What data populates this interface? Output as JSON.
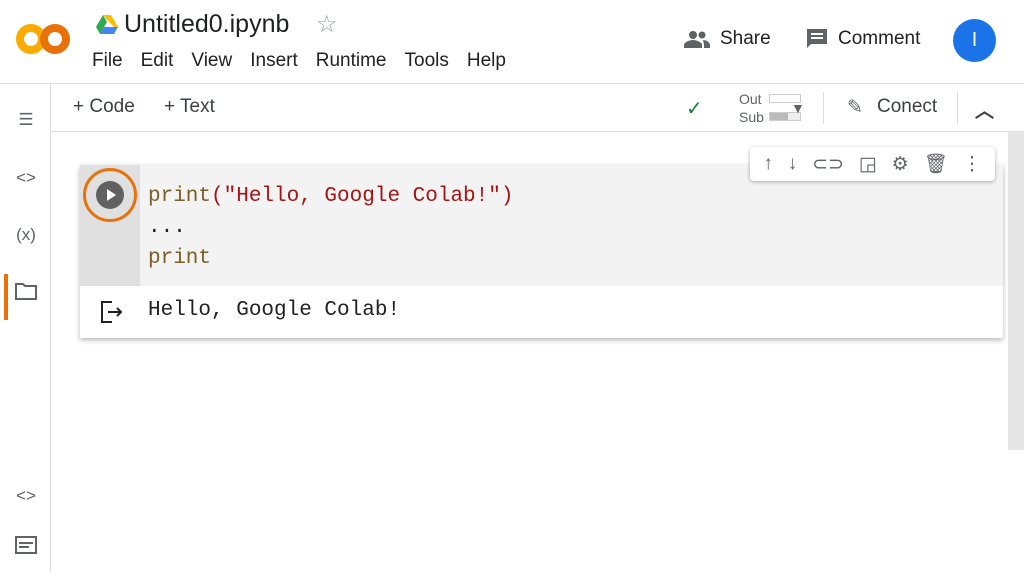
{
  "header": {
    "title": "Untitled0.ipynb",
    "menu": [
      "File",
      "Edit",
      "View",
      "Insert",
      "Runtime",
      "Tools",
      "Help"
    ],
    "share": "Share",
    "comment": "Comment",
    "avatar": "I"
  },
  "toolbar": {
    "add_code": "+ Code",
    "add_text": "+ Text",
    "ram_label": "Out",
    "disk_label": "Sub",
    "connect": "Conect"
  },
  "cell": {
    "code_lines": [
      {
        "fn": "print",
        "args": "(\"Hello, Google Colab!\")"
      },
      {
        "text": "..."
      },
      {
        "fn": "print"
      }
    ],
    "output": "Hello, Google Colab!"
  },
  "colors": {
    "accent": "#e8710a",
    "avatar": "#1a73e8",
    "check": "#188038"
  }
}
